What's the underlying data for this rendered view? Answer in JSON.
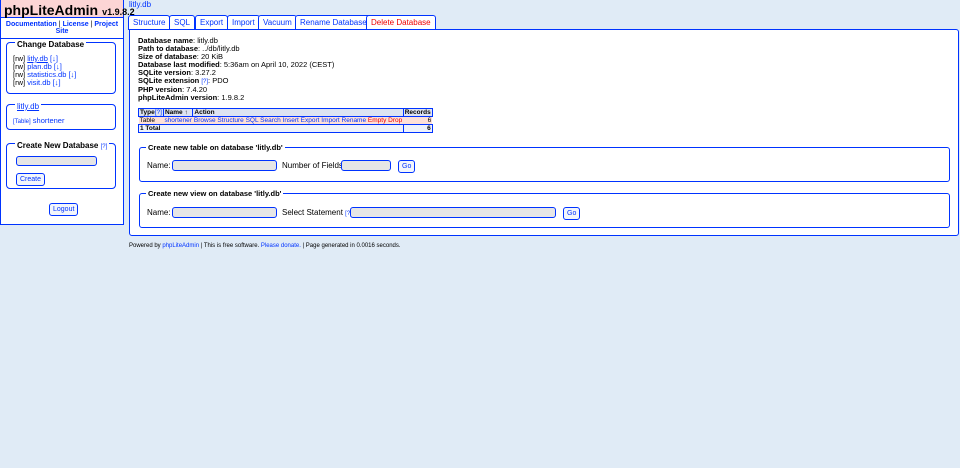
{
  "app": {
    "name": "phpLiteAdmin",
    "version": "v1.9.8.2"
  },
  "toplinks": [
    "Documentation",
    "License",
    "Project Site"
  ],
  "change_db": {
    "title": "Change Database",
    "items": [
      {
        "perm": "[rw]",
        "name": "litly.db",
        "tag": "[↓]"
      },
      {
        "perm": "[rw]",
        "name": "plan.db",
        "tag": "[↓]"
      },
      {
        "perm": "[rw]",
        "name": "statistics.db",
        "tag": "[↓]"
      },
      {
        "perm": "[rw]",
        "name": "visit.db",
        "tag": "[↓]"
      }
    ]
  },
  "current_db": {
    "title": "litly.db",
    "table_tag": "[Table]",
    "table_name": "shortener"
  },
  "create_db": {
    "title": "Create New Database",
    "help": "[?]",
    "button": "Create"
  },
  "logout": "Logout",
  "header_db": "litly.db",
  "tabs": [
    "Structure",
    "SQL",
    "Export",
    "Import",
    "Vacuum",
    "Rename Database",
    "Delete Database"
  ],
  "info": [
    {
      "label": "Database name",
      "value": ": litly.db"
    },
    {
      "label": "Path to database",
      "value": ": ../db/litly.db"
    },
    {
      "label": "Size of database",
      "value": ": 20 KiB"
    },
    {
      "label": "Database last modified",
      "value": ": 5:36am on April 10, 2022 (CEST)"
    },
    {
      "label": "SQLite version",
      "value": ": 3.27.2"
    },
    {
      "label": "SQLite extension",
      "value": ": PDO",
      "help": "[?]"
    },
    {
      "label": "PHP version",
      "value": ": 7.4.20"
    },
    {
      "label": "phpLiteAdmin version",
      "value": ": 1.9.8.2"
    }
  ],
  "table": {
    "headers": {
      "type": "Type",
      "type_help": "[?]",
      "name": "Name ↑",
      "action": "Action",
      "records": "Records"
    },
    "row": {
      "type": "Table",
      "name": "shortener",
      "actions": [
        "Browse",
        "Structure",
        "SQL",
        "Search",
        "Insert",
        "Export",
        "Import",
        "Rename",
        "Empty",
        "Drop"
      ],
      "records": "6"
    },
    "total": {
      "label": "1 Total",
      "records": "6"
    }
  },
  "new_table": {
    "legend": "Create new table on database 'litly.db'",
    "name_label": "Name:",
    "fields_label": "Number of Fields:",
    "go": "Go"
  },
  "new_view": {
    "legend": "Create new view on database 'litly.db'",
    "name_label": "Name:",
    "select_label": "Select Statement",
    "help": "[?]",
    "go": "Go"
  },
  "footer": {
    "pre": "Powered by ",
    "link1": "phpLiteAdmin",
    "mid": " | This is free software. ",
    "link2": "Please donate.",
    "post": " | Page generated in 0.0016 seconds."
  },
  "colors": {
    "accent": "#0033ff",
    "bg": "#e0ebf6",
    "logo_bg": "#fcd5d5",
    "danger": "#ee0000"
  }
}
